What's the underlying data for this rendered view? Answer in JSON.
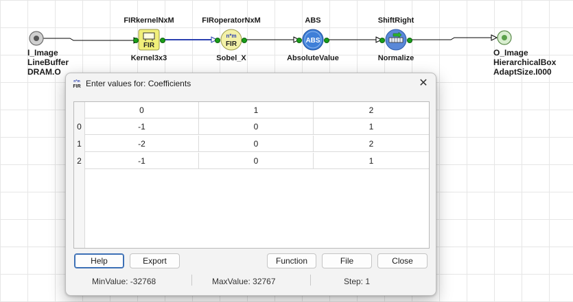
{
  "graph": {
    "input": {
      "lines": [
        "I_Image",
        "LineBuffer",
        "DRAM.O"
      ]
    },
    "output": {
      "lines": [
        "O_Image",
        "HierarchicalBox",
        "AdaptSize.I000"
      ]
    },
    "operators": [
      {
        "type": "FIRkernelNxM",
        "name": "Kernel3x3",
        "icon": "fir-kernel-icon",
        "icon_text": "FIR"
      },
      {
        "type": "FIRoperatorNxM",
        "name": "Sobel_X",
        "icon": "fir-operator-icon",
        "icon_text": "FIR",
        "icon_sup": "n*m"
      },
      {
        "type": "ABS",
        "name": "AbsoluteValue",
        "icon": "abs-icon",
        "icon_text": "ABS"
      },
      {
        "type": "ShiftRight",
        "name": "Normalize",
        "icon": "shift-right-icon"
      }
    ]
  },
  "dialog": {
    "title": "Enter values for: Coefficients",
    "icon_sup": "n*m",
    "icon_text": "FIR",
    "close_glyph": "✕",
    "grid": {
      "column_headers": [
        "0",
        "1",
        "2"
      ],
      "row_headers": [
        "0",
        "1",
        "2"
      ],
      "rows": [
        [
          "-1",
          "0",
          "1"
        ],
        [
          "-2",
          "0",
          "2"
        ],
        [
          "-1",
          "0",
          "1"
        ]
      ]
    },
    "buttons": {
      "help": "Help",
      "export": "Export",
      "function": "Function",
      "file": "File",
      "close": "Close"
    },
    "status": {
      "min": "MinValue: -32768",
      "max": "MaxValue: 32767",
      "step": "Step: 1"
    }
  },
  "colors": {
    "wire": "#000000",
    "selected_wire": "#2a3fb0",
    "pin": "#1a9e1a",
    "kernel_fill": "#f1ef7a",
    "operator_fill": "#f3f1a8",
    "abs_fill": "#3f7fd8",
    "shift_fill": "#5a88d8",
    "port_fill": "#7a7a7a"
  }
}
